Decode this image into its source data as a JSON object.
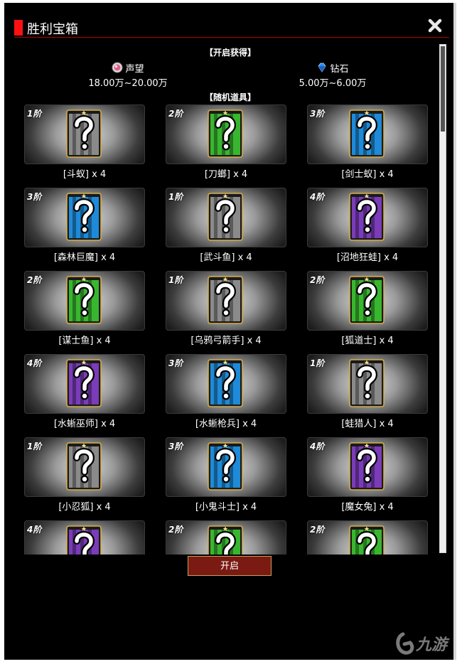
{
  "window": {
    "title": "胜利宝箱"
  },
  "open_section": {
    "header": "【开启获得】"
  },
  "rewards": [
    {
      "name": "声望",
      "amount": "18.00万~20.00万",
      "icon": "reputation-icon"
    },
    {
      "name": "钻石",
      "amount": "5.00万~6.00万",
      "icon": "diamond-icon"
    }
  ],
  "random_section": {
    "header": "【随机道具】"
  },
  "items": [
    {
      "tier": "1阶",
      "label": "[斗蚁] x 4",
      "color": "#8a8a8a"
    },
    {
      "tier": "2阶",
      "label": "[刀螂] x 4",
      "color": "#39b62f"
    },
    {
      "tier": "3阶",
      "label": "[剑士蚁] x 4",
      "color": "#1e8ad8"
    },
    {
      "tier": "3阶",
      "label": "[森林巨魔] x 4",
      "color": "#1e8ad8"
    },
    {
      "tier": "1阶",
      "label": "[武斗鱼] x 4",
      "color": "#8a8a8a"
    },
    {
      "tier": "4阶",
      "label": "[沼地狂蛙] x 4",
      "color": "#7a3cb8"
    },
    {
      "tier": "2阶",
      "label": "[谋士鱼] x 4",
      "color": "#39b62f"
    },
    {
      "tier": "1阶",
      "label": "[乌鸦弓箭手] x 4",
      "color": "#8a8a8a"
    },
    {
      "tier": "2阶",
      "label": "[狐道士] x 4",
      "color": "#39b62f"
    },
    {
      "tier": "4阶",
      "label": "[水蜥巫师] x 4",
      "color": "#7a3cb8"
    },
    {
      "tier": "3阶",
      "label": "[水蜥枪兵] x 4",
      "color": "#1e8ad8"
    },
    {
      "tier": "1阶",
      "label": "[蛙猎人] x 4",
      "color": "#8a8a8a"
    },
    {
      "tier": "1阶",
      "label": "[小忍狐] x 4",
      "color": "#8a8a8a"
    },
    {
      "tier": "3阶",
      "label": "[小鬼斗士] x 4",
      "color": "#1e8ad8"
    },
    {
      "tier": "4阶",
      "label": "[魔女兔] x 4",
      "color": "#7a3cb8"
    },
    {
      "tier": "4阶",
      "label": "",
      "color": "#7a3cb8"
    },
    {
      "tier": "2阶",
      "label": "",
      "color": "#39b62f"
    },
    {
      "tier": "2阶",
      "label": "",
      "color": "#39b62f"
    }
  ],
  "open_button": {
    "label": "开启"
  },
  "watermark": {
    "text": "九游"
  },
  "colors": {
    "accent_red": "#ff1111",
    "button_bg": "#7a1a12",
    "tier_gray": "#8a8a8a",
    "tier_green": "#39b62f",
    "tier_blue": "#1e8ad8",
    "tier_purple": "#7a3cb8"
  }
}
